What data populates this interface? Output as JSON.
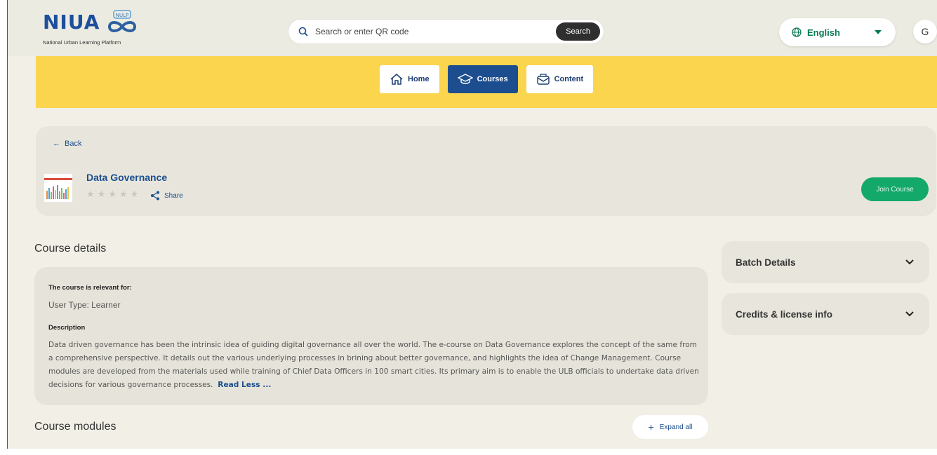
{
  "header": {
    "logo_text": "NIUA",
    "logo_badge": "NULP",
    "logo_subtitle": "National Urban Learning Platform",
    "search": {
      "placeholder": "Search or enter QR code",
      "button": "Search"
    },
    "language": "English",
    "avatar_initial": "G"
  },
  "nav": [
    {
      "label": "Home",
      "icon": "home-icon",
      "active": false
    },
    {
      "label": "Courses",
      "icon": "graduation-cap-icon",
      "active": true
    },
    {
      "label": "Content",
      "icon": "content-icon",
      "active": false
    }
  ],
  "course": {
    "back_label": "Back",
    "title": "Data Governance",
    "rating_stars": 5,
    "rating_value": 0,
    "share_label": "Share",
    "join_label": "Join Course"
  },
  "details": {
    "section_title": "Course details",
    "relevant_label": "The course is relevant for:",
    "user_type": "User Type: Learner",
    "description_label": "Description",
    "description": "Data driven governance has been the intrinsic idea of guiding digital governance all over the world. The e-course on Data Governance explores the concept of the same from a comprehensive perspective. It details out the various underlying processes in brining about better governance, and highlights the idea of Change Management. Course modules are developed from the materials used while training of Chief Data Officers in 100 smart cities. Its primary aim is to enable the ULB officials to undertake data driven decisions for various governance processes.",
    "read_less": "Read Less ..."
  },
  "modules": {
    "section_title": "Course modules",
    "expand_label": "Expand all"
  },
  "sidebar": {
    "batch_details": "Batch Details",
    "credits": "Credits & license info"
  },
  "colors": {
    "accent_blue": "#1c4e8f",
    "yellow_band": "#fcd54f",
    "join_green": "#13a96a",
    "language_green": "#0a7a55"
  }
}
